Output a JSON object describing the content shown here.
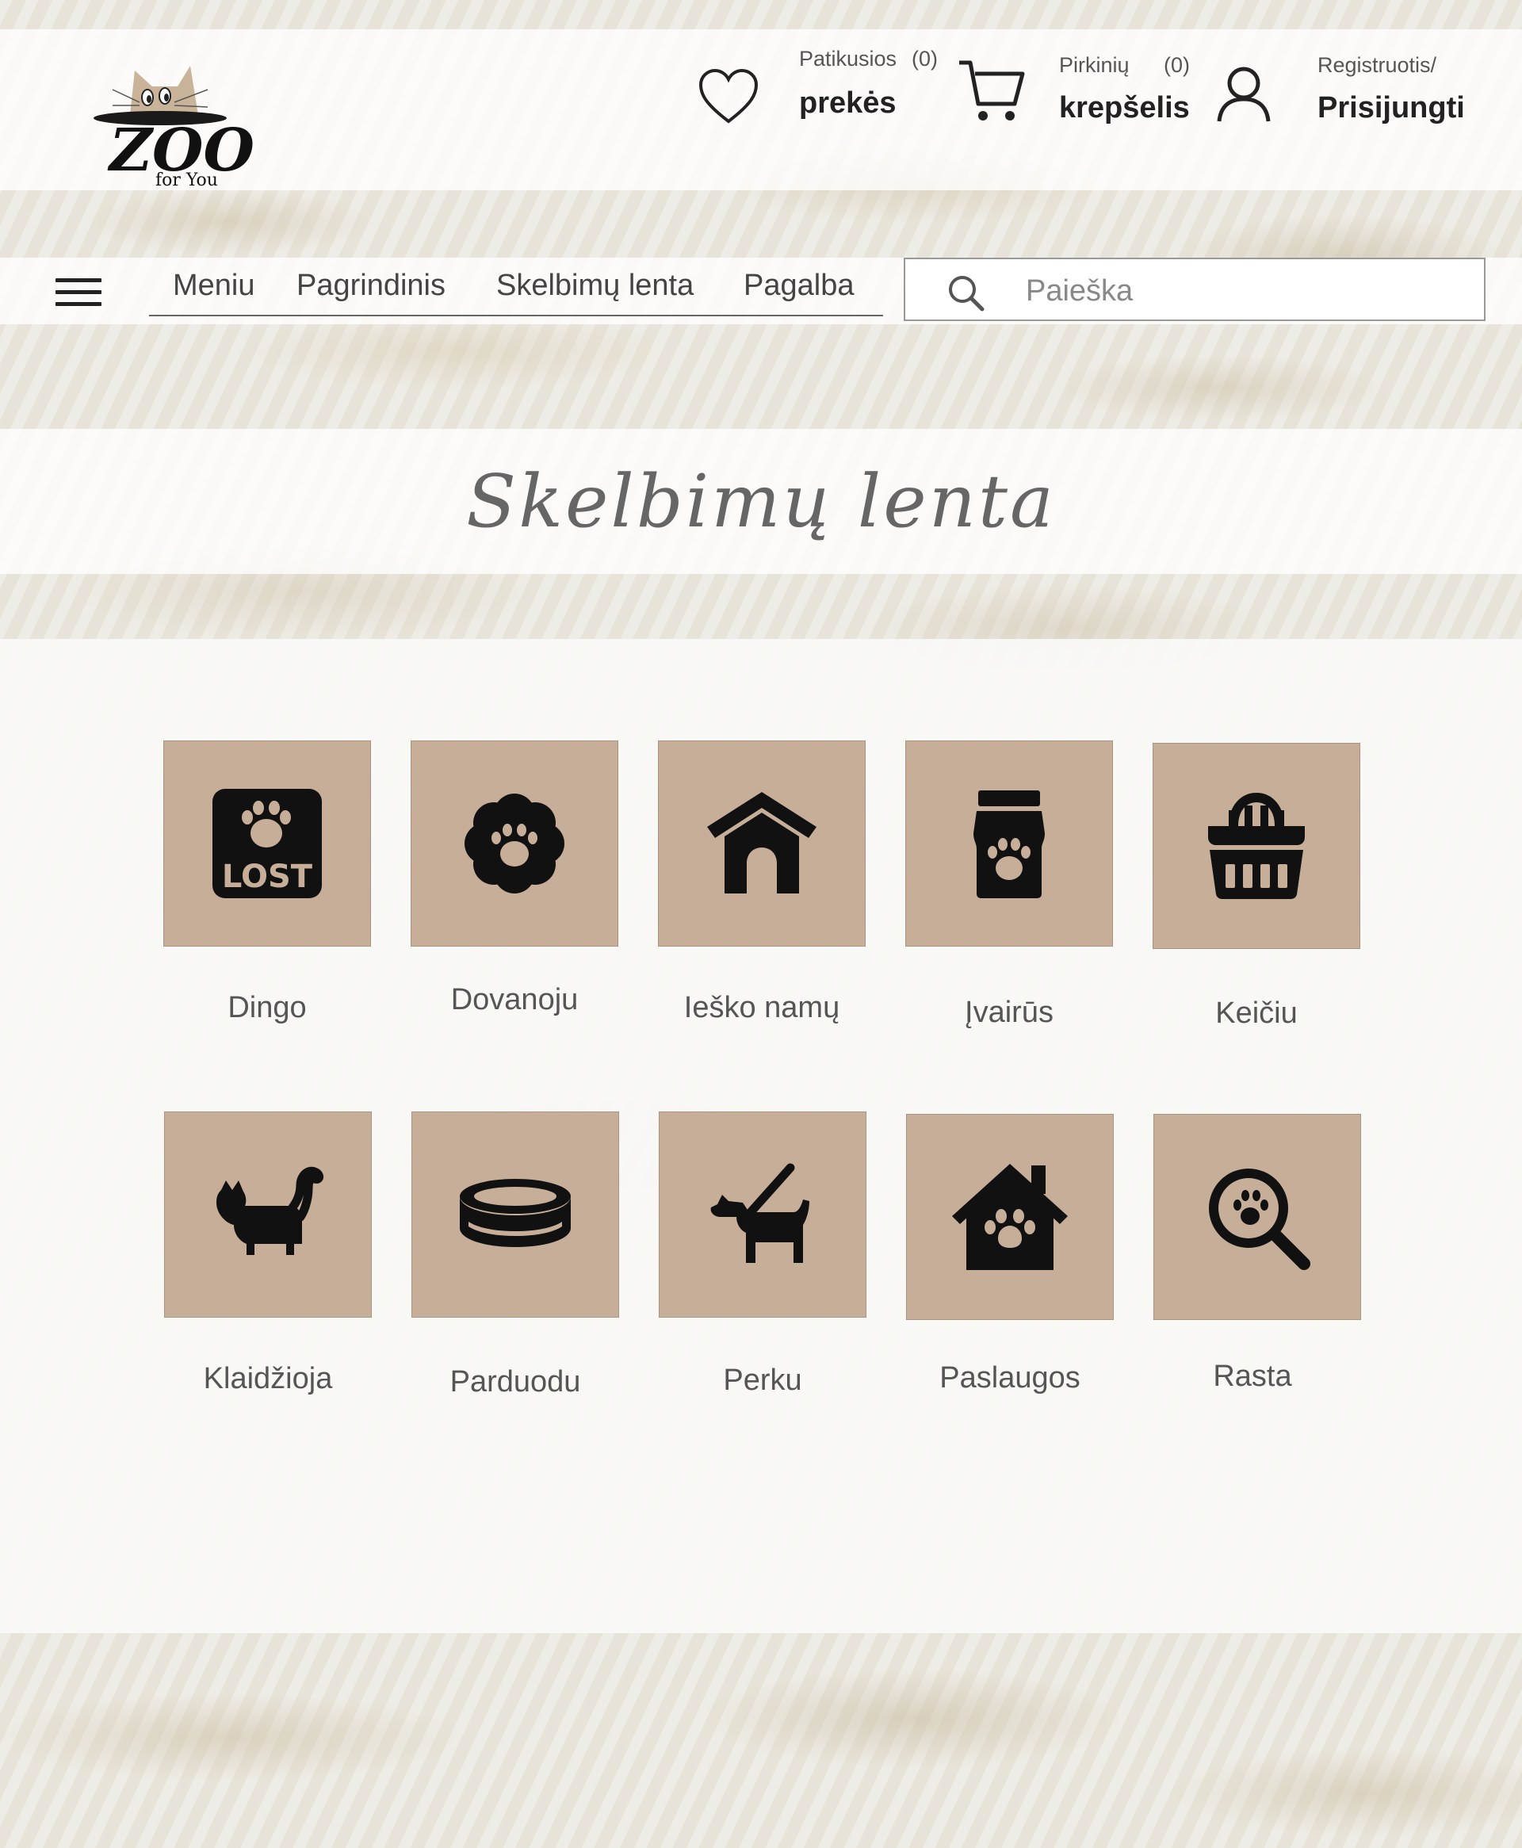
{
  "header": {
    "logo_text": "ZOO",
    "logo_subtext": "for You",
    "favorites": {
      "small": "Patikusios",
      "count": "(0)",
      "big": "prekės"
    },
    "cart": {
      "small": "Pirkinių",
      "count": "(0)",
      "big": "krepšelis"
    },
    "account": {
      "small": "Registruotis/",
      "big": "Prisijungti"
    }
  },
  "nav": {
    "links": [
      "Meniu",
      "Pagrindinis",
      "Skelbimų lenta",
      "Pagalba"
    ],
    "search_placeholder": "Paieška"
  },
  "page": {
    "title": "Skelbimų lenta"
  },
  "categories": [
    {
      "label": "Dingo",
      "icon": "lost-paw-icon"
    },
    {
      "label": "Dovanoju",
      "icon": "paw-flower-icon"
    },
    {
      "label": "Ieško namų",
      "icon": "doghouse-icon"
    },
    {
      "label": "Įvairūs",
      "icon": "pet-food-bag-icon"
    },
    {
      "label": "Keičiu",
      "icon": "pet-carrier-icon"
    },
    {
      "label": "Klaidžioja",
      "icon": "cat-icon"
    },
    {
      "label": "Parduodu",
      "icon": "pet-bowl-icon"
    },
    {
      "label": "Perku",
      "icon": "dog-leash-icon"
    },
    {
      "label": "Paslaugos",
      "icon": "paw-house-icon"
    },
    {
      "label": "Rasta",
      "icon": "paw-search-icon"
    }
  ],
  "colors": {
    "tile_bg": "#c7ae99",
    "logo_cat": "#c9b49a"
  }
}
